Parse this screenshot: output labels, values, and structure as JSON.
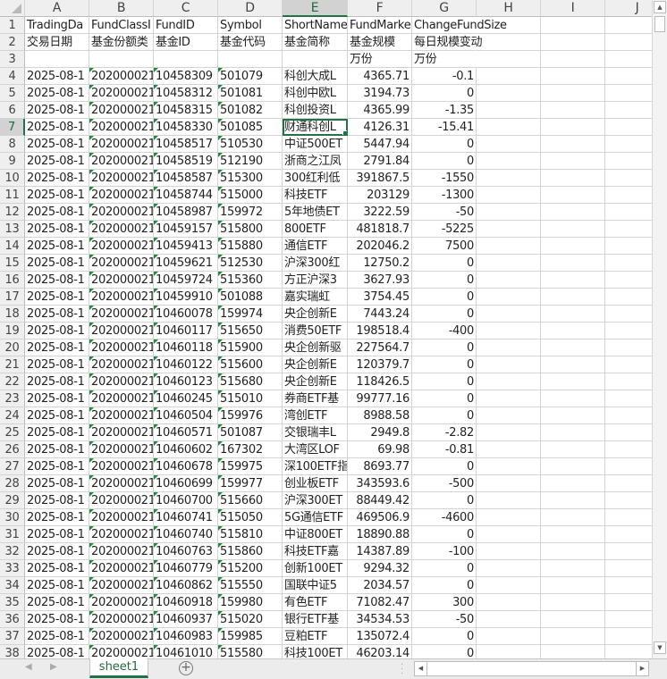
{
  "columns": [
    "A",
    "B",
    "C",
    "D",
    "E",
    "F",
    "G",
    "H",
    "I",
    "J"
  ],
  "selected": {
    "column": "E",
    "row": 7
  },
  "header_rows": [
    [
      "TradingDa",
      "FundClassI",
      "FundID",
      "Symbol",
      "ShortName",
      "FundMarke",
      "ChangeFundSize"
    ],
    [
      "交易日期",
      "基金份额类",
      "基金ID",
      "基金代码",
      "基金简称",
      "基金规模",
      "每日规模变动"
    ],
    [
      "",
      "",
      "",
      "",
      "",
      "万份",
      "万份"
    ]
  ],
  "rows": [
    [
      "2025-08-1",
      "202000021",
      "10458309",
      "501079",
      "科创大成L",
      "4365.71",
      "-0.1"
    ],
    [
      "2025-08-1",
      "202000021",
      "10458312",
      "501081",
      "科创中欧L",
      "3194.73",
      "0"
    ],
    [
      "2025-08-1",
      "202000021",
      "10458315",
      "501082",
      "科创投资L",
      "4365.99",
      "-1.35"
    ],
    [
      "2025-08-1",
      "202000021",
      "10458330",
      "501085",
      "财通科创L",
      "4126.31",
      "-15.41"
    ],
    [
      "2025-08-1",
      "202000021",
      "10458517",
      "510530",
      "中证500ET",
      "5447.94",
      "0"
    ],
    [
      "2025-08-1",
      "202000021",
      "10458519",
      "512190",
      "浙商之江凤",
      "2791.84",
      "0"
    ],
    [
      "2025-08-1",
      "202000021",
      "10458587",
      "515300",
      "300红利低",
      "391867.5",
      "-1550"
    ],
    [
      "2025-08-1",
      "202000021",
      "10458744",
      "515000",
      "科技ETF",
      "203129",
      "-1300"
    ],
    [
      "2025-08-1",
      "202000021",
      "10458987",
      "159972",
      "5年地债ET",
      "3222.59",
      "-50"
    ],
    [
      "2025-08-1",
      "202000021",
      "10459157",
      "515800",
      "800ETF",
      "481818.7",
      "-5225"
    ],
    [
      "2025-08-1",
      "202000021",
      "10459413",
      "515880",
      "通信ETF",
      "202046.2",
      "7500"
    ],
    [
      "2025-08-1",
      "202000021",
      "10459621",
      "512530",
      "沪深300红",
      "12750.2",
      "0"
    ],
    [
      "2025-08-1",
      "202000021",
      "10459724",
      "515360",
      "方正沪深3",
      "3627.93",
      "0"
    ],
    [
      "2025-08-1",
      "202000021",
      "10459910",
      "501088",
      "嘉实瑞虹",
      "3754.45",
      "0"
    ],
    [
      "2025-08-1",
      "202000021",
      "10460078",
      "159974",
      "央企创新E",
      "7443.24",
      "0"
    ],
    [
      "2025-08-1",
      "202000021",
      "10460117",
      "515650",
      "消费50ETF",
      "198518.4",
      "-400"
    ],
    [
      "2025-08-1",
      "202000021",
      "10460118",
      "515900",
      "央企创新驱",
      "227564.7",
      "0"
    ],
    [
      "2025-08-1",
      "202000021",
      "10460122",
      "515600",
      "央企创新E",
      "120379.7",
      "0"
    ],
    [
      "2025-08-1",
      "202000021",
      "10460123",
      "515680",
      "央企创新E",
      "118426.5",
      "0"
    ],
    [
      "2025-08-1",
      "202000021",
      "10460245",
      "515010",
      "券商ETF基",
      "99777.16",
      "0"
    ],
    [
      "2025-08-1",
      "202000021",
      "10460504",
      "159976",
      "湾创ETF",
      "8988.58",
      "0"
    ],
    [
      "2025-08-1",
      "202000021",
      "10460571",
      "501087",
      "交银瑞丰L",
      "2949.8",
      "-2.82"
    ],
    [
      "2025-08-1",
      "202000021",
      "10460602",
      "167302",
      "大湾区LOF",
      "69.98",
      "-0.81"
    ],
    [
      "2025-08-1",
      "202000021",
      "10460678",
      "159975",
      "深100ETF指",
      "8693.77",
      "0"
    ],
    [
      "2025-08-1",
      "202000021",
      "10460699",
      "159977",
      "创业板ETF",
      "343593.6",
      "-500"
    ],
    [
      "2025-08-1",
      "202000021",
      "10460700",
      "515660",
      "沪深300ET",
      "88449.42",
      "0"
    ],
    [
      "2025-08-1",
      "202000021",
      "10460741",
      "515050",
      "5G通信ETF",
      "469506.9",
      "-4600"
    ],
    [
      "2025-08-1",
      "202000021",
      "10460740",
      "515810",
      "中证800ET",
      "18890.88",
      "0"
    ],
    [
      "2025-08-1",
      "202000021",
      "10460763",
      "515860",
      "科技ETF嘉",
      "14387.89",
      "-100"
    ],
    [
      "2025-08-1",
      "202000021",
      "10460779",
      "515200",
      "创新100ET",
      "9294.32",
      "0"
    ],
    [
      "2025-08-1",
      "202000021",
      "10460862",
      "515550",
      "国联中证5",
      "2034.57",
      "0"
    ],
    [
      "2025-08-1",
      "202000021",
      "10460918",
      "159980",
      "有色ETF",
      "71082.47",
      "300"
    ],
    [
      "2025-08-1",
      "202000021",
      "10460937",
      "515020",
      "银行ETF基",
      "34534.53",
      "-50"
    ],
    [
      "2025-08-1",
      "202000021",
      "10460983",
      "159985",
      "豆粕ETF",
      "135072.4",
      "0"
    ],
    [
      "2025-08-1",
      "202000021",
      "10461010",
      "515580",
      "科技100ET",
      "46203.14",
      "0"
    ]
  ],
  "sheet_tab": "sheet1",
  "accent": "#217346"
}
